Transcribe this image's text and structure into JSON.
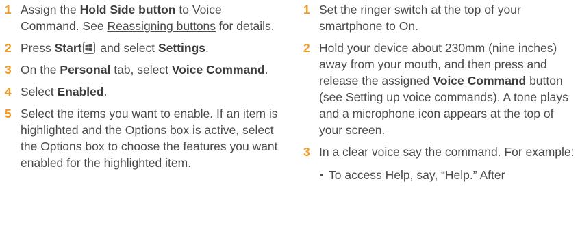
{
  "left_steps": [
    {
      "number": "1",
      "p1": "Assign the ",
      "b1": "Hold Side button",
      "p2": " to Voice Command. See ",
      "link": "Reassigning buttons",
      "p3": " for details."
    },
    {
      "number": "2",
      "p1": "Press ",
      "b1": "Start",
      "icon": "windows-start-icon",
      "p2": " and select ",
      "b2": "Settings",
      "p3": "."
    },
    {
      "number": "3",
      "p1": "On the ",
      "b1": "Personal",
      "p2": " tab, select ",
      "b2": "Voice Command",
      "p3": "."
    },
    {
      "number": "4",
      "p1": "Select ",
      "b1": "Enabled",
      "p2": "."
    },
    {
      "number": "5",
      "text": "Select the items you want to enable. If an item is highlighted and the Options box is active, select the Options box to choose the features you want enabled for the highlighted item."
    }
  ],
  "right_steps": [
    {
      "number": "1",
      "text": "Set the ringer switch at the top of your smartphone to On."
    },
    {
      "number": "2",
      "p1": "Hold your device about 230mm (nine inches) away from your mouth, and then press and release the assigned ",
      "b1": "Voice Command",
      "p2": " button (see ",
      "link": "Setting up voice commands",
      "p3": "). A tone plays and a microphone icon appears at the top of your screen."
    },
    {
      "number": "3",
      "text": "In a clear voice say the command. For example:",
      "bullets": [
        "To access Help, say, “Help.” After"
      ]
    }
  ],
  "colors": {
    "step_number": "#f29a1f",
    "body_text": "#4a4a4a"
  }
}
